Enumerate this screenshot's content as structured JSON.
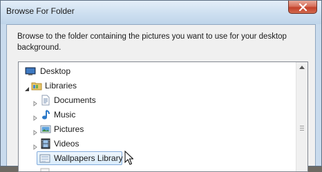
{
  "window": {
    "title": "Browse For Folder",
    "instructions": "Browse to the folder containing the pictures you want to use for your desktop background."
  },
  "tree": {
    "items": [
      {
        "label": "Desktop",
        "icon": "desktop-icon",
        "level": 0,
        "expander": "none"
      },
      {
        "label": "Libraries",
        "icon": "libraries-icon",
        "level": 0,
        "expander": "expanded"
      },
      {
        "label": "Documents",
        "icon": "documents-icon",
        "level": 1,
        "expander": "collapsed"
      },
      {
        "label": "Music",
        "icon": "music-icon",
        "level": 1,
        "expander": "collapsed"
      },
      {
        "label": "Pictures",
        "icon": "pictures-icon",
        "level": 1,
        "expander": "collapsed"
      },
      {
        "label": "Videos",
        "icon": "videos-icon",
        "level": 1,
        "expander": "collapsed"
      },
      {
        "label": "Wallpapers Library",
        "icon": "library-icon",
        "level": 1,
        "expander": "none",
        "selected": true
      }
    ]
  },
  "colors": {
    "selection_border": "#84acdd",
    "close_button": "#c4412a"
  }
}
